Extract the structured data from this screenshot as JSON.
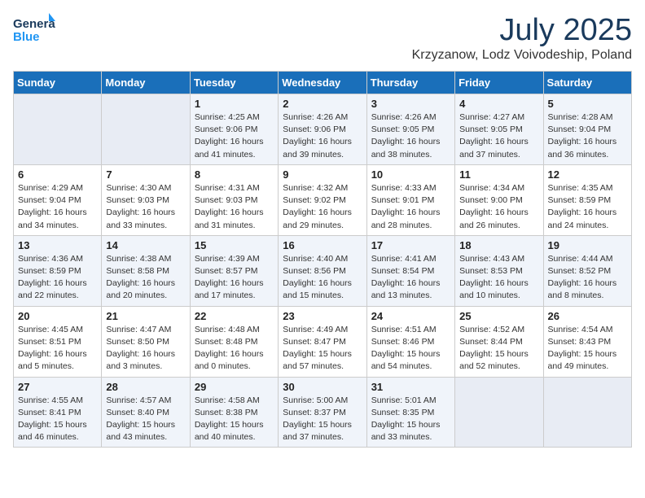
{
  "header": {
    "logo_general": "General",
    "logo_blue": "Blue",
    "month": "July 2025",
    "location": "Krzyzanow, Lodz Voivodeship, Poland"
  },
  "weekdays": [
    "Sunday",
    "Monday",
    "Tuesday",
    "Wednesday",
    "Thursday",
    "Friday",
    "Saturday"
  ],
  "weeks": [
    [
      {
        "day": "",
        "info": ""
      },
      {
        "day": "",
        "info": ""
      },
      {
        "day": "1",
        "info": "Sunrise: 4:25 AM\nSunset: 9:06 PM\nDaylight: 16 hours and 41 minutes."
      },
      {
        "day": "2",
        "info": "Sunrise: 4:26 AM\nSunset: 9:06 PM\nDaylight: 16 hours and 39 minutes."
      },
      {
        "day": "3",
        "info": "Sunrise: 4:26 AM\nSunset: 9:05 PM\nDaylight: 16 hours and 38 minutes."
      },
      {
        "day": "4",
        "info": "Sunrise: 4:27 AM\nSunset: 9:05 PM\nDaylight: 16 hours and 37 minutes."
      },
      {
        "day": "5",
        "info": "Sunrise: 4:28 AM\nSunset: 9:04 PM\nDaylight: 16 hours and 36 minutes."
      }
    ],
    [
      {
        "day": "6",
        "info": "Sunrise: 4:29 AM\nSunset: 9:04 PM\nDaylight: 16 hours and 34 minutes."
      },
      {
        "day": "7",
        "info": "Sunrise: 4:30 AM\nSunset: 9:03 PM\nDaylight: 16 hours and 33 minutes."
      },
      {
        "day": "8",
        "info": "Sunrise: 4:31 AM\nSunset: 9:03 PM\nDaylight: 16 hours and 31 minutes."
      },
      {
        "day": "9",
        "info": "Sunrise: 4:32 AM\nSunset: 9:02 PM\nDaylight: 16 hours and 29 minutes."
      },
      {
        "day": "10",
        "info": "Sunrise: 4:33 AM\nSunset: 9:01 PM\nDaylight: 16 hours and 28 minutes."
      },
      {
        "day": "11",
        "info": "Sunrise: 4:34 AM\nSunset: 9:00 PM\nDaylight: 16 hours and 26 minutes."
      },
      {
        "day": "12",
        "info": "Sunrise: 4:35 AM\nSunset: 8:59 PM\nDaylight: 16 hours and 24 minutes."
      }
    ],
    [
      {
        "day": "13",
        "info": "Sunrise: 4:36 AM\nSunset: 8:59 PM\nDaylight: 16 hours and 22 minutes."
      },
      {
        "day": "14",
        "info": "Sunrise: 4:38 AM\nSunset: 8:58 PM\nDaylight: 16 hours and 20 minutes."
      },
      {
        "day": "15",
        "info": "Sunrise: 4:39 AM\nSunset: 8:57 PM\nDaylight: 16 hours and 17 minutes."
      },
      {
        "day": "16",
        "info": "Sunrise: 4:40 AM\nSunset: 8:56 PM\nDaylight: 16 hours and 15 minutes."
      },
      {
        "day": "17",
        "info": "Sunrise: 4:41 AM\nSunset: 8:54 PM\nDaylight: 16 hours and 13 minutes."
      },
      {
        "day": "18",
        "info": "Sunrise: 4:43 AM\nSunset: 8:53 PM\nDaylight: 16 hours and 10 minutes."
      },
      {
        "day": "19",
        "info": "Sunrise: 4:44 AM\nSunset: 8:52 PM\nDaylight: 16 hours and 8 minutes."
      }
    ],
    [
      {
        "day": "20",
        "info": "Sunrise: 4:45 AM\nSunset: 8:51 PM\nDaylight: 16 hours and 5 minutes."
      },
      {
        "day": "21",
        "info": "Sunrise: 4:47 AM\nSunset: 8:50 PM\nDaylight: 16 hours and 3 minutes."
      },
      {
        "day": "22",
        "info": "Sunrise: 4:48 AM\nSunset: 8:48 PM\nDaylight: 16 hours and 0 minutes."
      },
      {
        "day": "23",
        "info": "Sunrise: 4:49 AM\nSunset: 8:47 PM\nDaylight: 15 hours and 57 minutes."
      },
      {
        "day": "24",
        "info": "Sunrise: 4:51 AM\nSunset: 8:46 PM\nDaylight: 15 hours and 54 minutes."
      },
      {
        "day": "25",
        "info": "Sunrise: 4:52 AM\nSunset: 8:44 PM\nDaylight: 15 hours and 52 minutes."
      },
      {
        "day": "26",
        "info": "Sunrise: 4:54 AM\nSunset: 8:43 PM\nDaylight: 15 hours and 49 minutes."
      }
    ],
    [
      {
        "day": "27",
        "info": "Sunrise: 4:55 AM\nSunset: 8:41 PM\nDaylight: 15 hours and 46 minutes."
      },
      {
        "day": "28",
        "info": "Sunrise: 4:57 AM\nSunset: 8:40 PM\nDaylight: 15 hours and 43 minutes."
      },
      {
        "day": "29",
        "info": "Sunrise: 4:58 AM\nSunset: 8:38 PM\nDaylight: 15 hours and 40 minutes."
      },
      {
        "day": "30",
        "info": "Sunrise: 5:00 AM\nSunset: 8:37 PM\nDaylight: 15 hours and 37 minutes."
      },
      {
        "day": "31",
        "info": "Sunrise: 5:01 AM\nSunset: 8:35 PM\nDaylight: 15 hours and 33 minutes."
      },
      {
        "day": "",
        "info": ""
      },
      {
        "day": "",
        "info": ""
      }
    ]
  ]
}
